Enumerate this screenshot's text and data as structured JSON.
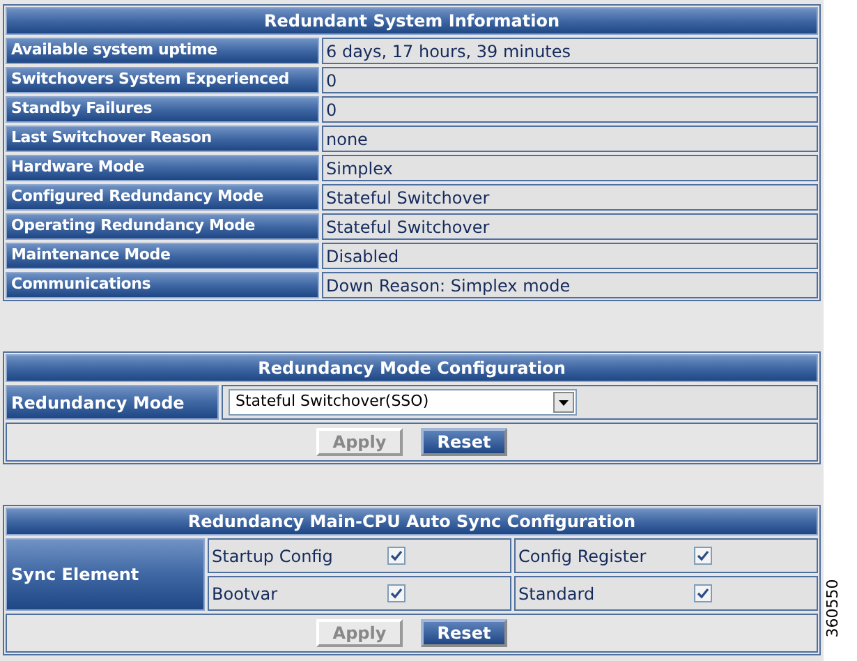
{
  "system_info": {
    "title": "Redundant System Information",
    "rows": [
      {
        "label": "Available system uptime",
        "value": "6 days, 17 hours, 39 minutes"
      },
      {
        "label": "Switchovers System Experienced",
        "value": "0"
      },
      {
        "label": "Standby Failures",
        "value": "0"
      },
      {
        "label": "Last Switchover Reason",
        "value": "none"
      },
      {
        "label": "Hardware Mode",
        "value": "Simplex"
      },
      {
        "label": "Configured Redundancy Mode",
        "value": "Stateful Switchover"
      },
      {
        "label": "Operating Redundancy Mode",
        "value": "Stateful Switchover"
      },
      {
        "label": "Maintenance Mode",
        "value": "Disabled"
      },
      {
        "label": "Communications",
        "value": "Down Reason: Simplex mode"
      }
    ]
  },
  "mode_config": {
    "title": "Redundancy Mode Configuration",
    "label": "Redundancy Mode",
    "select_value": "Stateful Switchover(SSO)",
    "buttons": [
      {
        "label": "Apply",
        "disabled": true
      },
      {
        "label": "Reset",
        "disabled": false
      }
    ]
  },
  "sync_config": {
    "title": "Redundancy Main-CPU Auto Sync Configuration",
    "label": "Sync Element",
    "items": [
      {
        "label": "Startup Config",
        "checked": true
      },
      {
        "label": "Config Register",
        "checked": true
      },
      {
        "label": "Bootvar",
        "checked": true
      },
      {
        "label": "Standard",
        "checked": true
      }
    ],
    "buttons": [
      {
        "label": "Apply",
        "disabled": true
      },
      {
        "label": "Reset",
        "disabled": false
      }
    ]
  },
  "figure_id": "360550"
}
